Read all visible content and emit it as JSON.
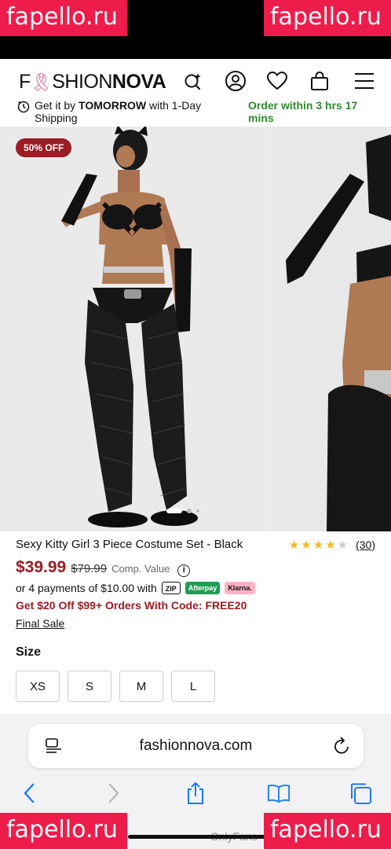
{
  "watermark": "fapello.ru",
  "header": {
    "logo_light": "FASHION",
    "logo_bold": "NOVA",
    "logo_f": "F",
    "logo_a": "A",
    "logo_s": "SHION"
  },
  "shipping": {
    "get_it_by": "Get it by ",
    "day": "TOMORROW",
    "method": " with 1-Day Shipping",
    "order_within": "Order within 3 hrs 17 mins"
  },
  "product": {
    "badge": "50% OFF",
    "title": "Sexy Kitty Girl 3 Piece Costume Set - Black",
    "rating": 4,
    "review_count": "(30)",
    "price": "$39.99",
    "old_price": "$79.99",
    "comp_value": "Comp. Value",
    "installments": "or 4 payments of $10.00 with",
    "zip": "ZIP",
    "afterpay": "Afterpay",
    "klarna": "Klarna.",
    "promo": "Get $20 Off $99+ Orders With Code: FREE20",
    "final_sale": "Final Sale",
    "size_label": "Size",
    "sizes": [
      "XS",
      "S",
      "M",
      "L"
    ]
  },
  "browser": {
    "url": "fashionnova.com"
  },
  "footer_text": "OnlyFans"
}
